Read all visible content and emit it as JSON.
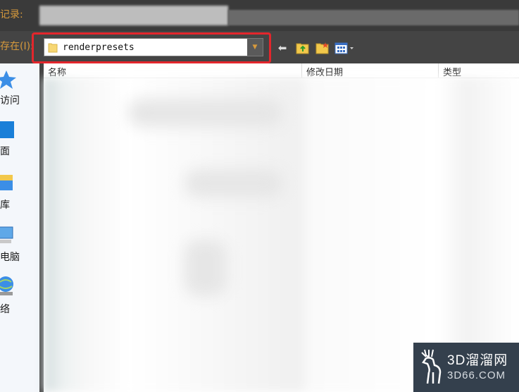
{
  "toolbar": {
    "history_label": "记录:",
    "save_in_label": "存在(I):",
    "path_value": "renderpresets"
  },
  "sidebar": {
    "items": [
      {
        "label": "访问",
        "icon": "star-icon"
      },
      {
        "label": "面",
        "icon": "desktop-icon"
      },
      {
        "label": "库",
        "icon": "library-icon"
      },
      {
        "label": "电脑",
        "icon": "computer-icon"
      },
      {
        "label": "络",
        "icon": "network-icon"
      }
    ]
  },
  "file_list": {
    "columns": [
      "名称",
      "修改日期",
      "类型"
    ]
  },
  "watermark": {
    "title": "3D溜溜网",
    "subtitle": "3D66.COM"
  },
  "colors": {
    "accent": "#d79a3c",
    "highlight": "#e3262c",
    "dark_bar": "#444444"
  }
}
